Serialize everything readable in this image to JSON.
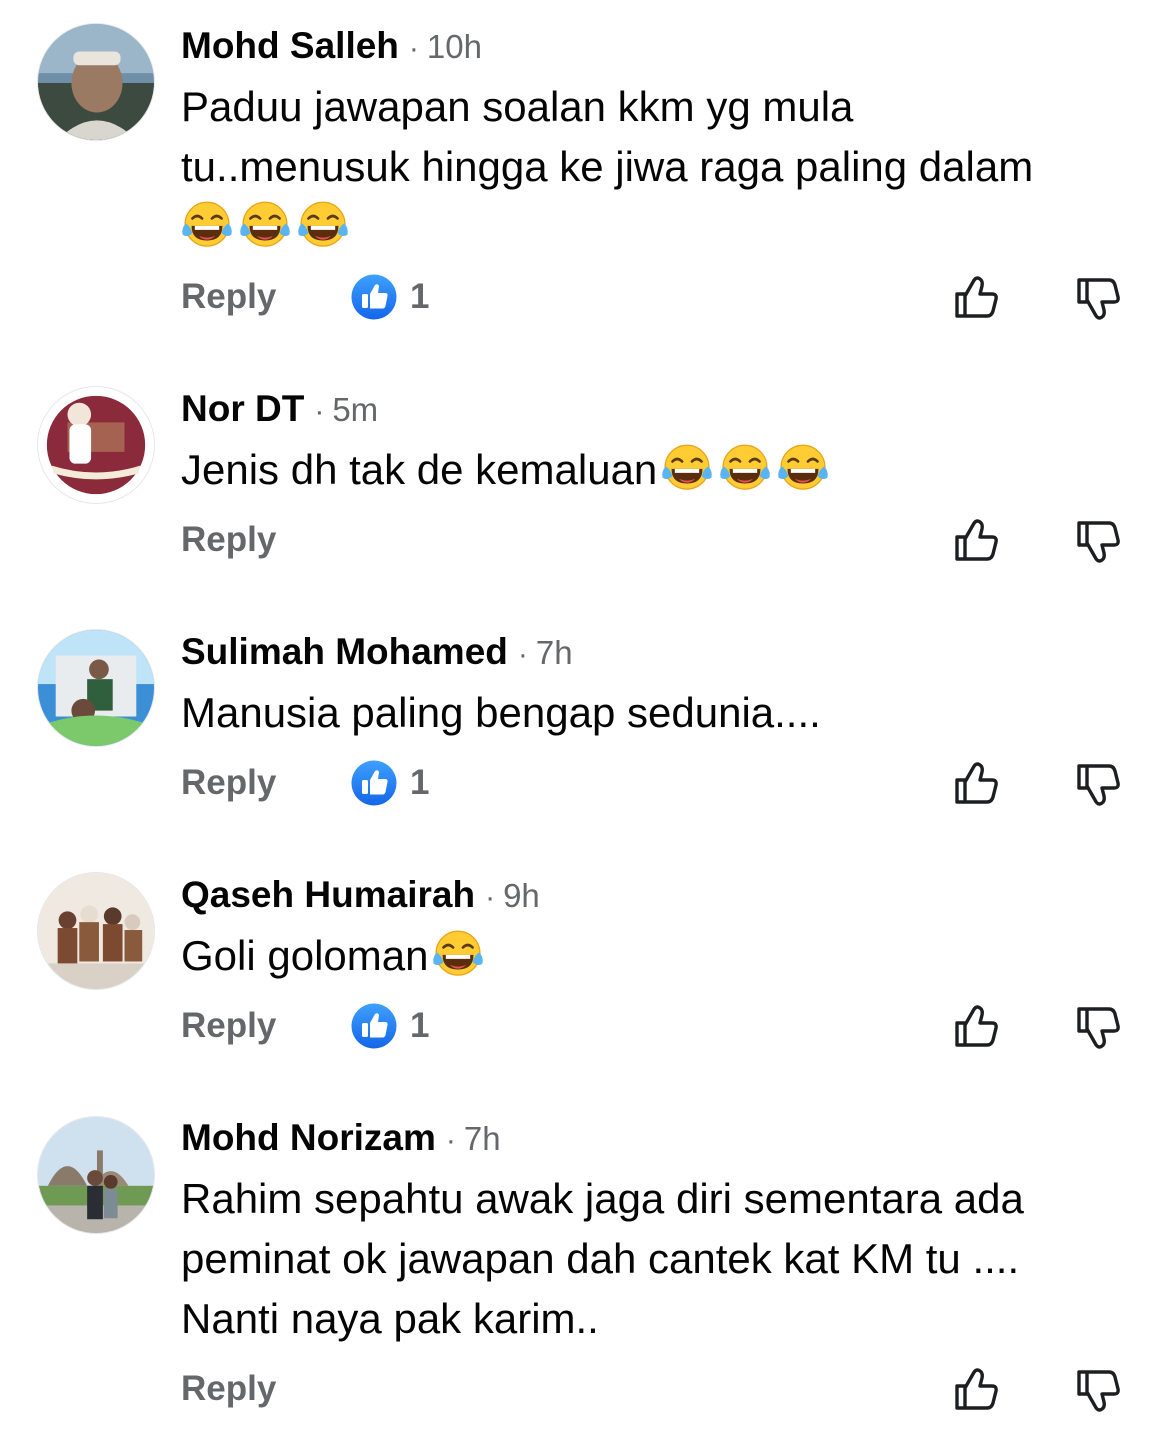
{
  "colors": {
    "secondary_text": "#65676b",
    "primary_text": "#050505",
    "like_blue": "#1877f2"
  },
  "comments": [
    {
      "author": "Mohd Salleh",
      "time": "10h",
      "lines": [
        "Paduu jawapan soalan kkm yg mula",
        "tu..menusuk hingga ke jiwa raga paling dalam"
      ],
      "trailing_emoji": [
        "tears-of-joy-emoji",
        "tears-of-joy-emoji",
        "tears-of-joy-emoji"
      ],
      "reply_label": "Reply",
      "like_count": "1"
    },
    {
      "author": "Nor DT",
      "time": "5m",
      "lines": [
        "Jenis dh tak de kemaluan"
      ],
      "inline_emoji": [
        "tears-of-joy-emoji",
        "tears-of-joy-emoji",
        "tears-of-joy-emoji"
      ],
      "reply_label": "Reply"
    },
    {
      "author": "Sulimah Mohamed",
      "time": "7h",
      "lines": [
        "Manusia paling bengap sedunia...."
      ],
      "reply_label": "Reply",
      "like_count": "1"
    },
    {
      "author": "Qaseh Humairah",
      "time": "9h",
      "lines": [
        "Goli goloman"
      ],
      "inline_emoji": [
        "tears-of-joy-emoji"
      ],
      "reply_label": "Reply",
      "like_count": "1"
    },
    {
      "author": "Mohd Norizam",
      "time": "7h",
      "lines": [
        "Rahim sepahtu awak jaga diri sementara ada",
        "peminat ok jawapan dah cantek kat KM tu ....",
        "Nanti naya pak karim.."
      ],
      "reply_label": "Reply"
    }
  ],
  "separator": "·"
}
